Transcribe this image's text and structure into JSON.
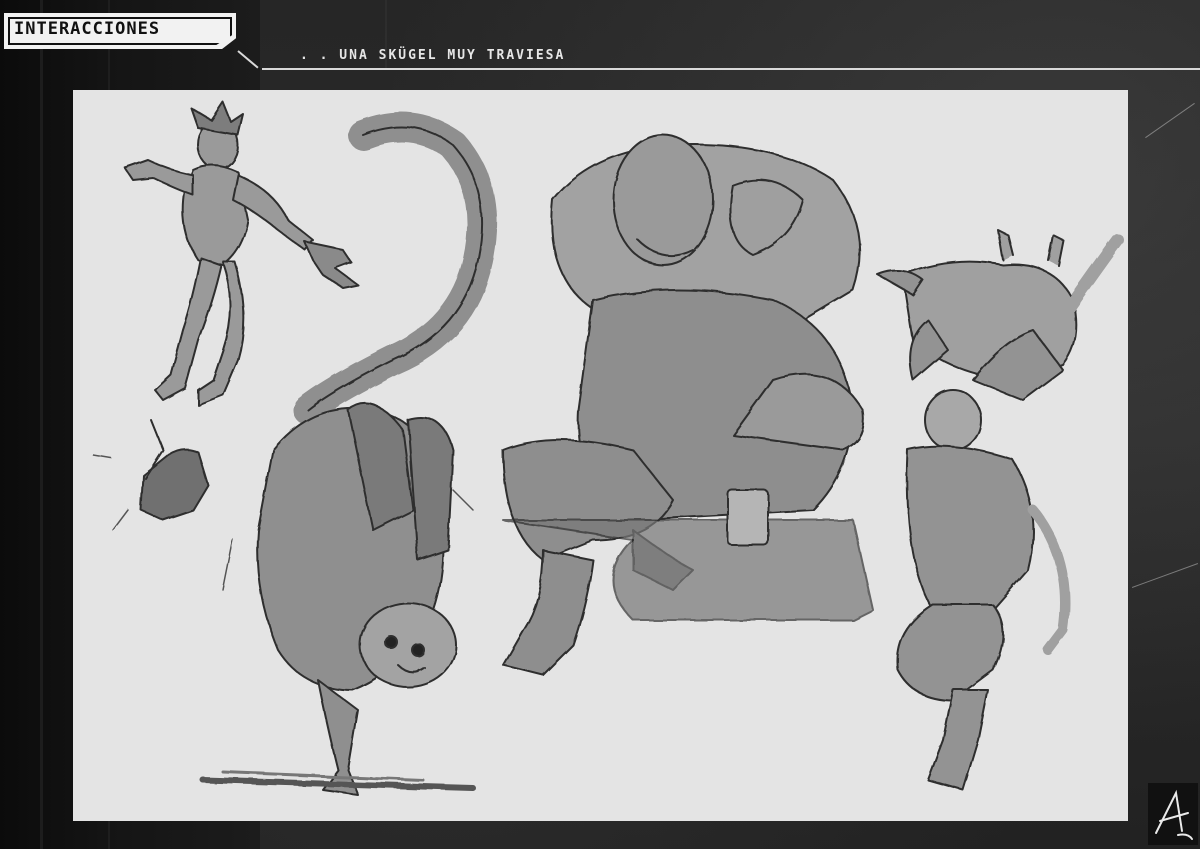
{
  "header": {
    "title": "INTERACCIONES",
    "subtitle": ". . UNA SKÜGEL MUY TRAVIESA"
  },
  "colors": {
    "background": "#1e1e1e",
    "canvas": "#e4e4e4",
    "sketch_fill": "#8f8f8f",
    "sketch_line": "#2e2e2e",
    "header_text": "#e6e6e6",
    "title_plate": "#f2f2f2"
  },
  "artwork": {
    "figures": [
      {
        "name": "leaping-human-figure"
      },
      {
        "name": "long-tailed-creature"
      },
      {
        "name": "large-seated-figure-in-fur-coat"
      },
      {
        "name": "figure-carrying-creature"
      }
    ],
    "signature_icon": "signature-mark"
  }
}
